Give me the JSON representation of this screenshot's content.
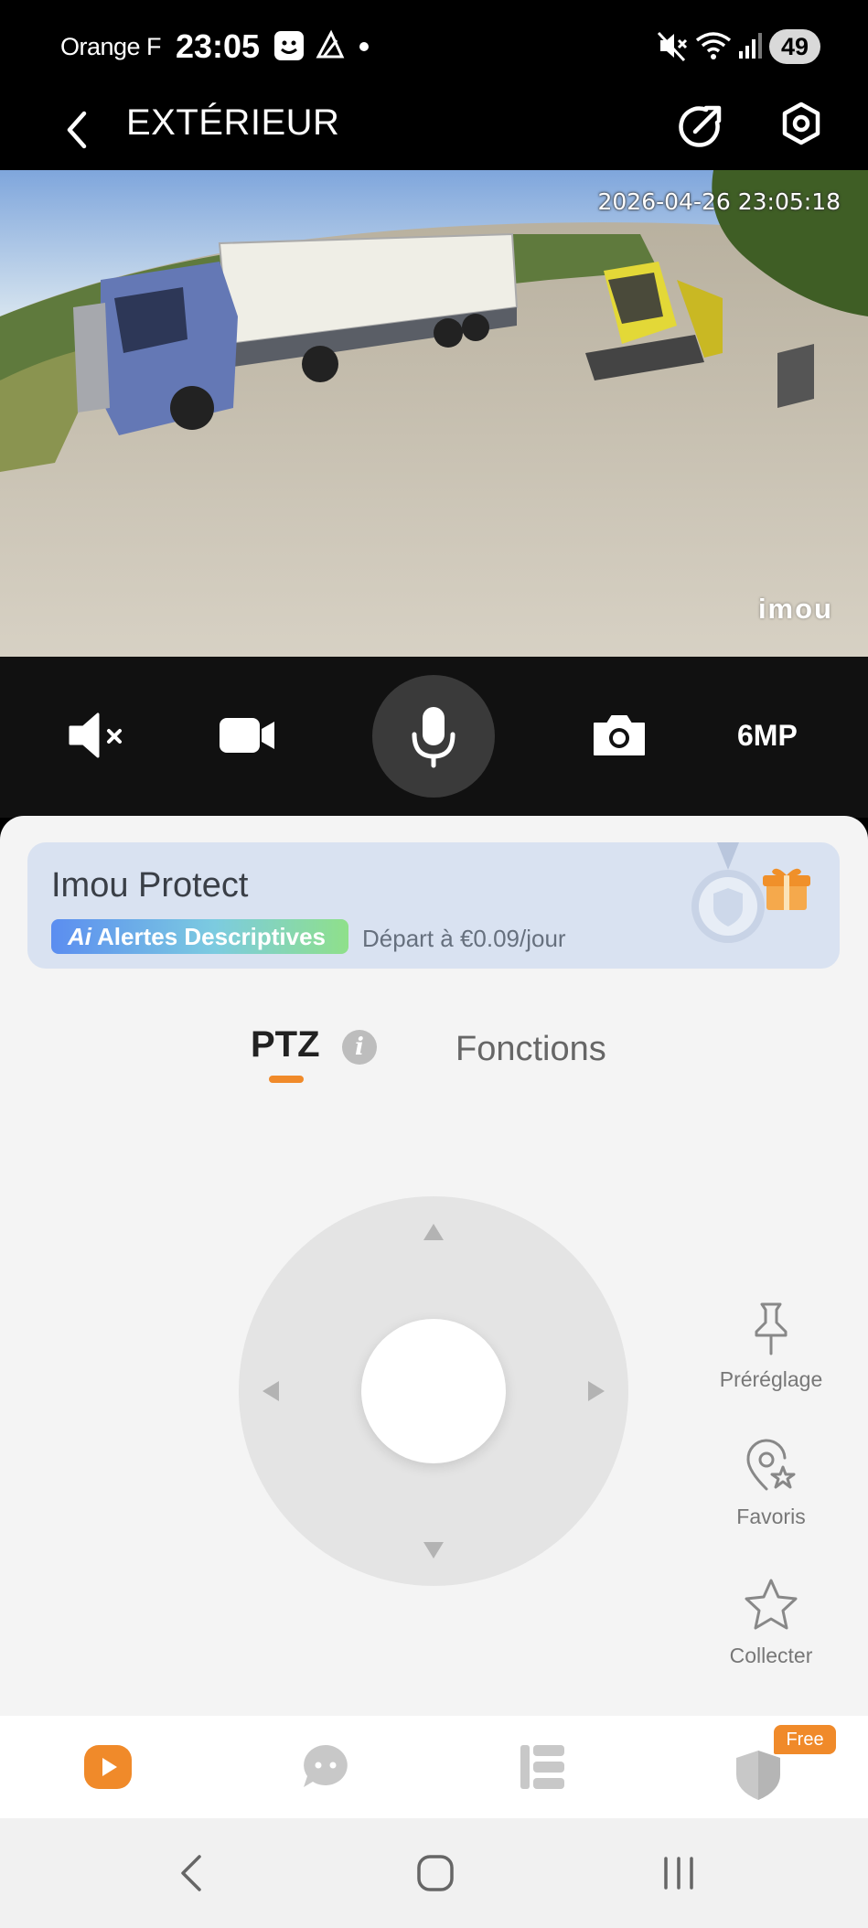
{
  "status_bar": {
    "carrier": "Orange F",
    "time": "23:05",
    "battery": "49",
    "icons": [
      "assistant-face-icon",
      "notification-icon",
      "dot-icon",
      "mute-icon",
      "wifi-icon",
      "signal-icon"
    ]
  },
  "header": {
    "title": "EXTÉRIEUR",
    "back_icon": "back-arrow-icon",
    "share_icon": "share-icon",
    "settings_icon": "settings-hexagon-icon"
  },
  "video": {
    "timestamp": "2026-04-26 23:05:18",
    "watermark": "imou"
  },
  "controls": {
    "mute_icon": "speaker-muted-icon",
    "record_icon": "video-record-icon",
    "mic_icon": "microphone-icon",
    "snapshot_icon": "camera-icon",
    "resolution": "6MP"
  },
  "promo": {
    "title": "Imou Protect",
    "badge_mark": "Ai",
    "badge": "Alertes Descriptives",
    "price": "Départ à €0.09/jour"
  },
  "tabs": {
    "ptz": "PTZ",
    "info": "i",
    "functions": "Fonctions"
  },
  "side_actions": {
    "preset": "Préréglage",
    "favorites": "Favoris",
    "collect": "Collecter"
  },
  "bottom_nav": {
    "free_badge": "Free",
    "items": [
      "live-play-icon",
      "message-icon",
      "list-icon",
      "shield-icon"
    ]
  },
  "colors": {
    "accent": "#f08a2a",
    "panel_bg": "#f4f4f4",
    "promo_bg": "#d9e2f1"
  }
}
